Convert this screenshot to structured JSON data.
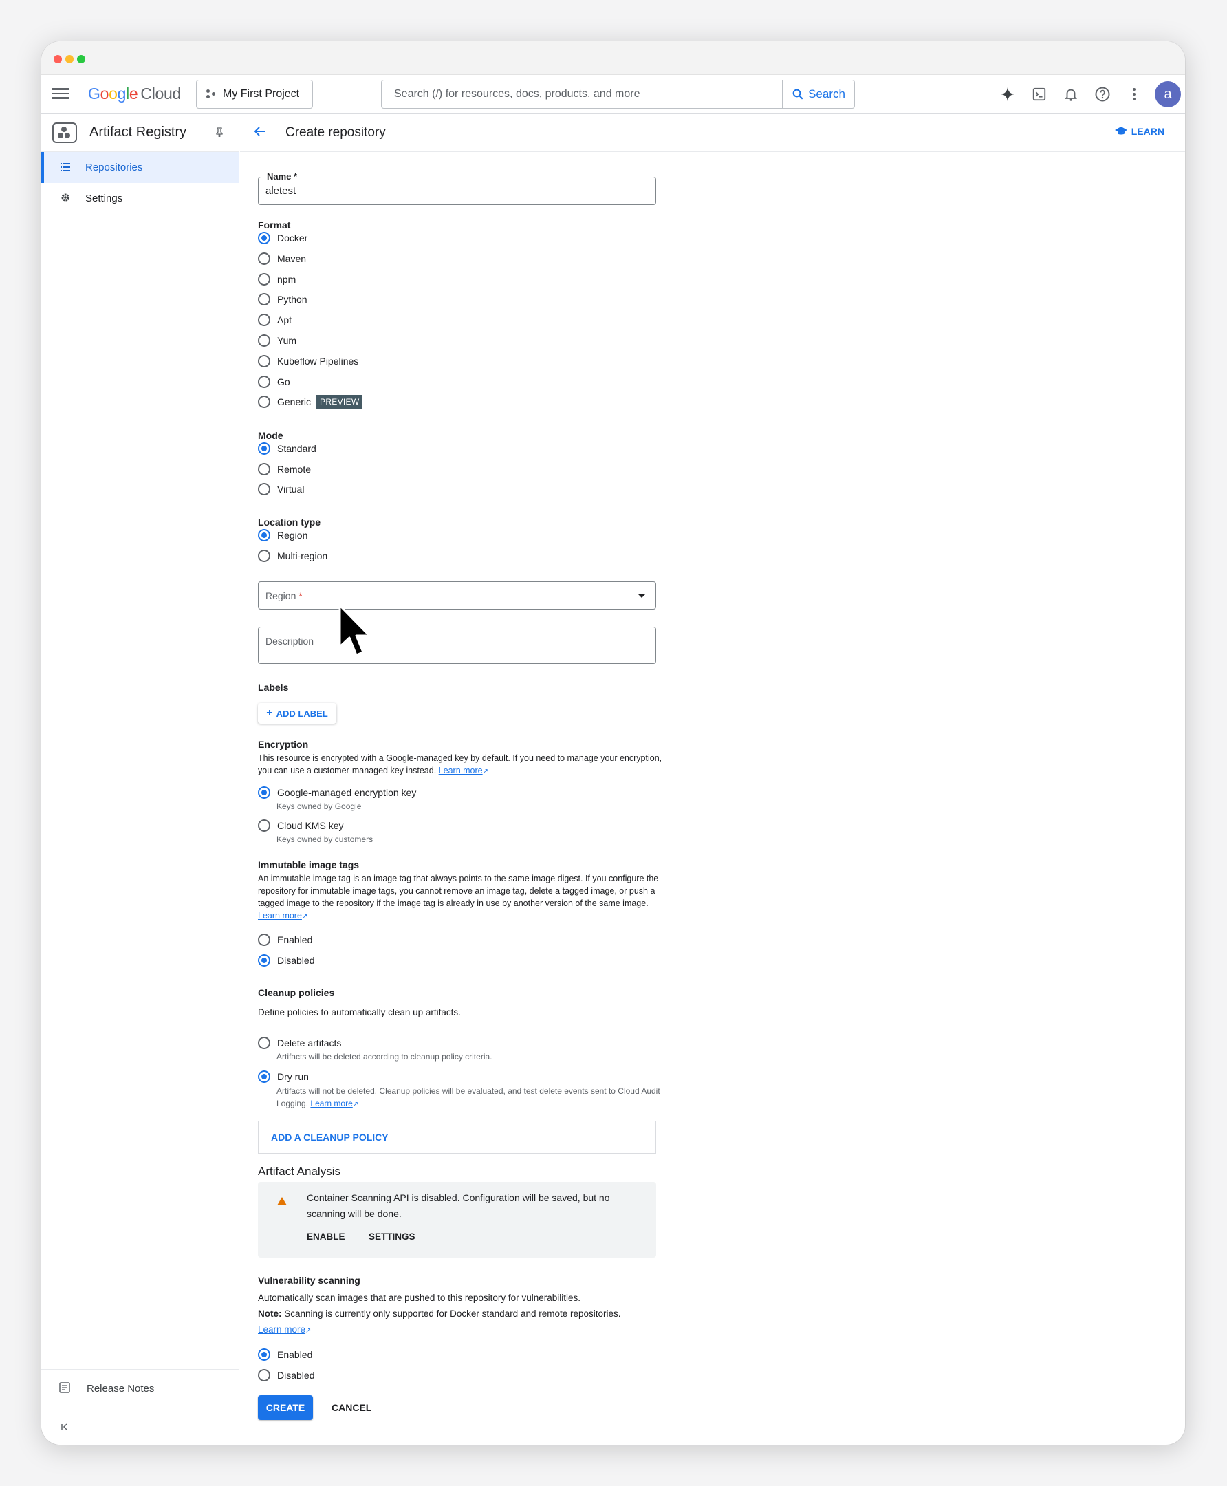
{
  "topbar": {
    "brand_google": "Google",
    "brand_cloud": "Cloud",
    "project": "My First Project",
    "search_placeholder": "Search (/) for resources, docs, products, and more",
    "search_button": "Search",
    "avatar_letter": "a"
  },
  "sidebar": {
    "title": "Artifact Registry",
    "items": [
      {
        "label": "Repositories",
        "icon": "list-icon",
        "active": true
      },
      {
        "label": "Settings",
        "icon": "gear-icon",
        "active": false
      }
    ],
    "release_notes": "Release Notes"
  },
  "header": {
    "title": "Create repository",
    "learn": "LEARN"
  },
  "form": {
    "name_label": "Name *",
    "name_value": "aletest",
    "format_label": "Format",
    "format_options": [
      "Docker",
      "Maven",
      "npm",
      "Python",
      "Apt",
      "Yum",
      "Kubeflow Pipelines",
      "Go",
      "Generic"
    ],
    "format_selected": "Docker",
    "preview_badge": "PREVIEW",
    "mode_label": "Mode",
    "mode_options": [
      "Standard",
      "Remote",
      "Virtual"
    ],
    "mode_selected": "Standard",
    "location_label": "Location type",
    "location_options": [
      "Region",
      "Multi-region"
    ],
    "location_selected": "Region",
    "region_placeholder": "Region",
    "region_required": "*",
    "description_placeholder": "Description",
    "labels_label": "Labels",
    "add_label": "ADD LABEL",
    "encryption_label": "Encryption",
    "encryption_text": "This resource is encrypted with a Google-managed key by default. If you need to manage your encryption, you can use a customer-managed key instead.",
    "learn_more": "Learn more",
    "enc_option_1": "Google-managed encryption key",
    "enc_option_1_sub": "Keys owned by Google",
    "enc_option_2": "Cloud KMS key",
    "enc_option_2_sub": "Keys owned by customers",
    "immutable_label": "Immutable image tags",
    "immutable_text": "An immutable image tag is an image tag that always points to the same image digest. If you configure the repository for immutable image tags, you cannot remove an image tag, delete a tagged image, or push a tagged image to the repository if the image tag is already in use by another version of the same image.",
    "immutable_options": [
      "Enabled",
      "Disabled"
    ],
    "immutable_selected": "Disabled",
    "cleanup_label": "Cleanup policies",
    "cleanup_text": "Define policies to automatically clean up artifacts.",
    "cleanup_opt_1": "Delete artifacts",
    "cleanup_opt_1_sub": "Artifacts will be deleted according to cleanup policy criteria.",
    "cleanup_opt_2": "Dry run",
    "cleanup_opt_2_sub": "Artifacts will not be deleted. Cleanup policies will be evaluated, and test delete events sent to Cloud Audit Logging.",
    "add_cleanup": "ADD A CLEANUP POLICY",
    "artifact_analysis": "Artifact Analysis",
    "warning_text": "Container Scanning API is disabled. Configuration will be saved, but no scanning will be done.",
    "enable_btn": "ENABLE",
    "settings_btn": "SETTINGS",
    "vuln_label": "Vulnerability scanning",
    "vuln_text": "Automatically scan images that are pushed to this repository for vulnerabilities.",
    "vuln_note_bold": "Note:",
    "vuln_note": "Scanning is currently only supported for Docker standard and remote repositories.",
    "vuln_options": [
      "Enabled",
      "Disabled"
    ],
    "vuln_selected": "Enabled",
    "create": "CREATE",
    "cancel": "CANCEL"
  },
  "colors": {
    "accent": "#1a73e8",
    "warning": "#e37400"
  }
}
